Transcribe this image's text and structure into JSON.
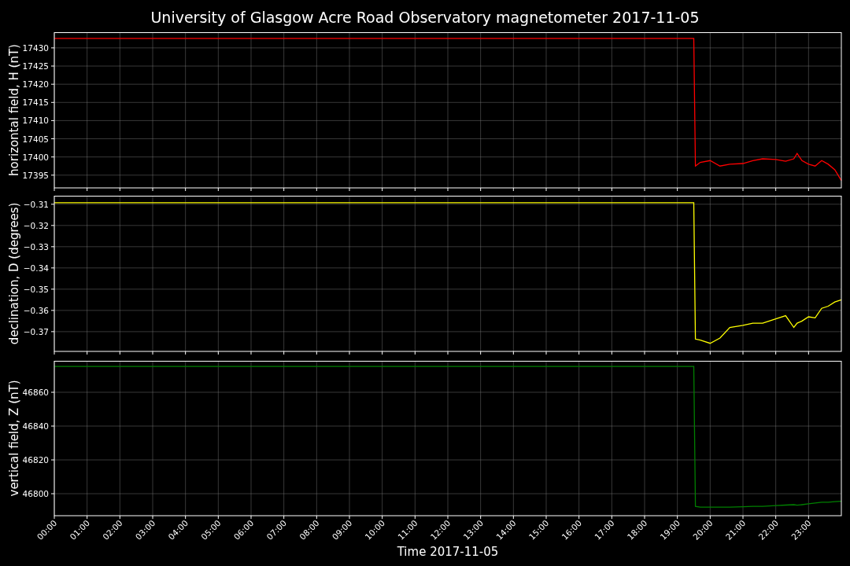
{
  "figure": {
    "title": "University of Glasgow Acre Road Observatory magnetometer 2017-11-05"
  },
  "panels": [
    {
      "chart_data": {
        "type": "line",
        "ylabel": "horizontal field, H (nT)",
        "grid": true,
        "x": [
          0,
          19.5,
          19.55,
          19.7,
          20,
          20.3,
          20.6,
          21,
          21.3,
          21.6,
          22,
          22.3,
          22.55,
          22.65,
          22.8,
          23,
          23.2,
          23.4,
          23.6,
          23.8,
          24
        ],
        "series": [
          {
            "color": "#ff0000",
            "values": [
              17432.6,
              17432.6,
              17397.5,
              17398.5,
              17399,
              17397.5,
              17398,
              17398.2,
              17399,
              17399.5,
              17399.3,
              17398.8,
              17399.5,
              17401,
              17399,
              17398,
              17397.5,
              17399,
              17398,
              17396.5,
              17393.5
            ]
          }
        ],
        "xlim": [
          0,
          24
        ],
        "ylim": [
          17391.5,
          17434.3
        ],
        "yticks": [
          {
            "value": 17395,
            "label": "17395"
          },
          {
            "value": 17400,
            "label": "17400"
          },
          {
            "value": 17405,
            "label": "17405"
          },
          {
            "value": 17410,
            "label": "17410"
          },
          {
            "value": 17415,
            "label": "17415"
          },
          {
            "value": 17420,
            "label": "17420"
          },
          {
            "value": 17425,
            "label": "17425"
          },
          {
            "value": 17430,
            "label": "17430"
          }
        ]
      }
    },
    {
      "chart_data": {
        "type": "line",
        "ylabel": "declination, D (degrees)",
        "grid": true,
        "x": [
          0,
          19.5,
          19.55,
          19.7,
          20,
          20.3,
          20.6,
          21,
          21.3,
          21.6,
          22,
          22.3,
          22.55,
          22.65,
          22.8,
          23,
          23.2,
          23.4,
          23.6,
          23.8,
          24
        ],
        "series": [
          {
            "color": "#ffff00",
            "values": [
              -0.3093,
              -0.3093,
              -0.3735,
              -0.374,
              -0.3755,
              -0.373,
              -0.368,
              -0.367,
              -0.366,
              -0.366,
              -0.364,
              -0.3625,
              -0.368,
              -0.366,
              -0.365,
              -0.363,
              -0.3635,
              -0.359,
              -0.358,
              -0.356,
              -0.355
            ]
          }
        ],
        "xlim": [
          0,
          24
        ],
        "ylim": [
          -0.3793,
          -0.306
        ],
        "yticks": [
          {
            "value": -0.37,
            "label": "−0.37"
          },
          {
            "value": -0.36,
            "label": "−0.36"
          },
          {
            "value": -0.35,
            "label": "−0.35"
          },
          {
            "value": -0.34,
            "label": "−0.34"
          },
          {
            "value": -0.33,
            "label": "−0.33"
          },
          {
            "value": -0.32,
            "label": "−0.32"
          },
          {
            "value": -0.31,
            "label": "−0.31"
          }
        ]
      }
    },
    {
      "chart_data": {
        "type": "line",
        "xlabel": "Time 2017-11-05",
        "ylabel": "vertical field, Z (nT)",
        "grid": true,
        "x": [
          0,
          19.5,
          19.55,
          19.7,
          20,
          20.3,
          20.6,
          21,
          21.3,
          21.6,
          22,
          22.3,
          22.55,
          22.65,
          22.8,
          23,
          23.2,
          23.4,
          23.6,
          23.8,
          24
        ],
        "series": [
          {
            "color": "#008000",
            "values": [
              46875.3,
              46875.3,
              46792.5,
              46792,
              46792,
              46792,
              46792,
              46792.3,
              46792.5,
              46792.5,
              46793,
              46793.3,
              46793.5,
              46793.2,
              46793.5,
              46794,
              46794.5,
              46795,
              46795,
              46795.3,
              46795.5
            ]
          }
        ],
        "xlim": [
          0,
          24
        ],
        "ylim": [
          46787,
          46878.6
        ],
        "xticks": [
          {
            "value": 0,
            "label": "00:00"
          },
          {
            "value": 1,
            "label": "01:00"
          },
          {
            "value": 2,
            "label": "02:00"
          },
          {
            "value": 3,
            "label": "03:00"
          },
          {
            "value": 4,
            "label": "04:00"
          },
          {
            "value": 5,
            "label": "05:00"
          },
          {
            "value": 6,
            "label": "06:00"
          },
          {
            "value": 7,
            "label": "07:00"
          },
          {
            "value": 8,
            "label": "08:00"
          },
          {
            "value": 9,
            "label": "09:00"
          },
          {
            "value": 10,
            "label": "10:00"
          },
          {
            "value": 11,
            "label": "11:00"
          },
          {
            "value": 12,
            "label": "12:00"
          },
          {
            "value": 13,
            "label": "13:00"
          },
          {
            "value": 14,
            "label": "14:00"
          },
          {
            "value": 15,
            "label": "15:00"
          },
          {
            "value": 16,
            "label": "16:00"
          },
          {
            "value": 17,
            "label": "17:00"
          },
          {
            "value": 18,
            "label": "18:00"
          },
          {
            "value": 19,
            "label": "19:00"
          },
          {
            "value": 20,
            "label": "20:00"
          },
          {
            "value": 21,
            "label": "21:00"
          },
          {
            "value": 22,
            "label": "22:00"
          },
          {
            "value": 23,
            "label": "23:00"
          }
        ],
        "yticks": [
          {
            "value": 46800,
            "label": "46800"
          },
          {
            "value": 46820,
            "label": "46820"
          },
          {
            "value": 46840,
            "label": "46840"
          },
          {
            "value": 46860,
            "label": "46860"
          }
        ]
      }
    }
  ]
}
